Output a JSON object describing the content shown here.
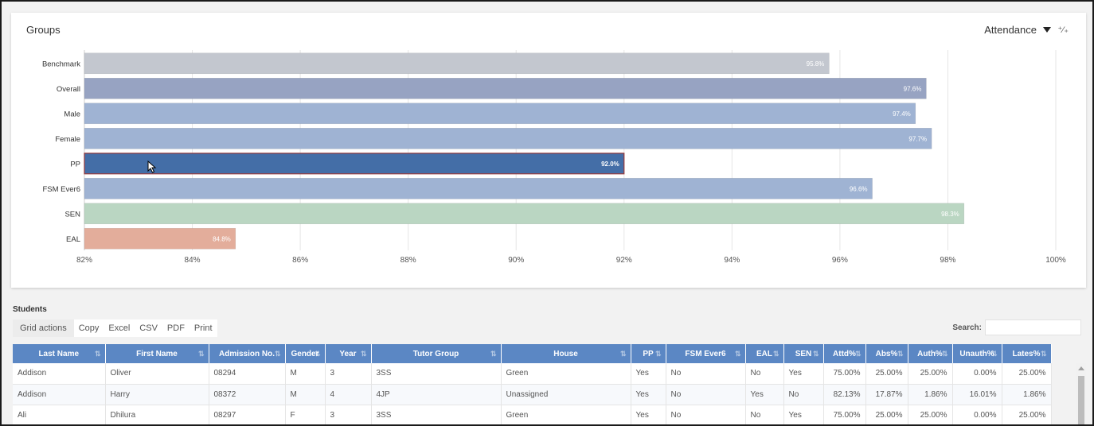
{
  "card": {
    "title": "Groups",
    "selector": "Attendance",
    "collapse_icon": "collapse-arrows-icon"
  },
  "chart_data": {
    "type": "bar",
    "orientation": "horizontal",
    "categories": [
      "Benchmark",
      "Overall",
      "Male",
      "Female",
      "PP",
      "FSM Ever6",
      "SEN",
      "EAL"
    ],
    "values": [
      95.8,
      97.6,
      97.4,
      97.7,
      92.0,
      96.6,
      98.3,
      84.8
    ],
    "data_labels": [
      "95.8%",
      "97.6%",
      "97.4%",
      "97.7%",
      "92.0%",
      "96.6%",
      "98.3%",
      "84.8%"
    ],
    "colors": [
      "#c3c7cf",
      "#97a3c2",
      "#9fb3d3",
      "#9fb3d3",
      "#446ea7",
      "#9fb3d3",
      "#bad6c2",
      "#e3ad9b"
    ],
    "highlight_border": "#9a3a3a",
    "highlighted": "PP",
    "xlim": [
      82,
      100
    ],
    "xticks": [
      82,
      84,
      86,
      88,
      90,
      92,
      94,
      96,
      98,
      100
    ],
    "xtick_labels": [
      "82%",
      "84%",
      "86%",
      "88%",
      "90%",
      "92%",
      "94%",
      "96%",
      "98%",
      "100%"
    ],
    "grid": true
  },
  "students": {
    "title": "Students",
    "grid_actions_label": "Grid actions",
    "actions": [
      "Copy",
      "Excel",
      "CSV",
      "PDF",
      "Print"
    ],
    "search_label": "Search:",
    "search_value": "",
    "columns": [
      "Last Name",
      "First Name",
      "Admission No.",
      "Gender",
      "Year",
      "Tutor Group",
      "House",
      "PP",
      "FSM Ever6",
      "EAL",
      "SEN",
      "Attd%",
      "Abs%",
      "Auth%",
      "Unauth%",
      "Lates%"
    ],
    "rows": [
      [
        "Addison",
        "Oliver",
        "08294",
        "M",
        "3",
        "3SS",
        "Green",
        "Yes",
        "No",
        "No",
        "Yes",
        "75.00%",
        "25.00%",
        "25.00%",
        "0.00%",
        "25.00%"
      ],
      [
        "Addison",
        "Harry",
        "08372",
        "M",
        "4",
        "4JP",
        "Unassigned",
        "Yes",
        "No",
        "Yes",
        "No",
        "82.13%",
        "17.87%",
        "1.86%",
        "16.01%",
        "1.86%"
      ],
      [
        "Ali",
        "Dhilura",
        "08297",
        "F",
        "3",
        "3SS",
        "Green",
        "Yes",
        "No",
        "No",
        "Yes",
        "75.00%",
        "25.00%",
        "25.00%",
        "0.00%",
        "25.00%"
      ]
    ]
  },
  "colors": {
    "header_bg": "#5b87c4",
    "accent_pp": "#446ea7"
  }
}
